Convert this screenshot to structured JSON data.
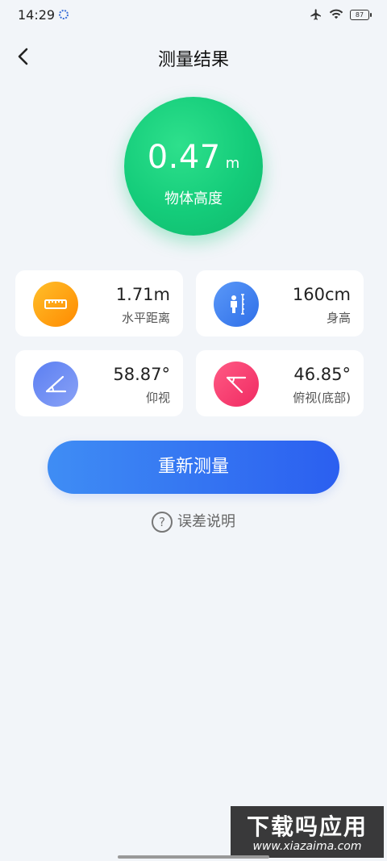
{
  "status_bar": {
    "time": "14:29",
    "battery": "87"
  },
  "header": {
    "title": "测量结果"
  },
  "result": {
    "value": "0.47",
    "unit": "m",
    "label": "物体高度"
  },
  "cards": [
    {
      "value": "1.71m",
      "label": "水平距离",
      "icon": "ruler-icon",
      "color_from": "#ffb21a",
      "color_to": "#ff8a00"
    },
    {
      "value": "160cm",
      "label": "身高",
      "icon": "person-height-icon",
      "color_from": "#4f8ff7",
      "color_to": "#2f6fe8"
    },
    {
      "value": "58.87°",
      "label": "仰视",
      "icon": "elevation-angle-icon",
      "color_from": "#5b7ff2",
      "color_to": "#8aa2f6"
    },
    {
      "value": "46.85°",
      "label": "俯视(底部)",
      "icon": "depression-angle-icon",
      "color_from": "#ff4c7a",
      "color_to": "#f02a62"
    }
  ],
  "actions": {
    "remeasure": "重新测量",
    "error_explain": "误差说明"
  },
  "watermark": {
    "title": "下载吗应用",
    "url": "www.xiazaima.com"
  },
  "colors": {
    "accent_green": "#14cc7a",
    "button_blue": "#2b5ff0",
    "background": "#f2f5f9"
  }
}
